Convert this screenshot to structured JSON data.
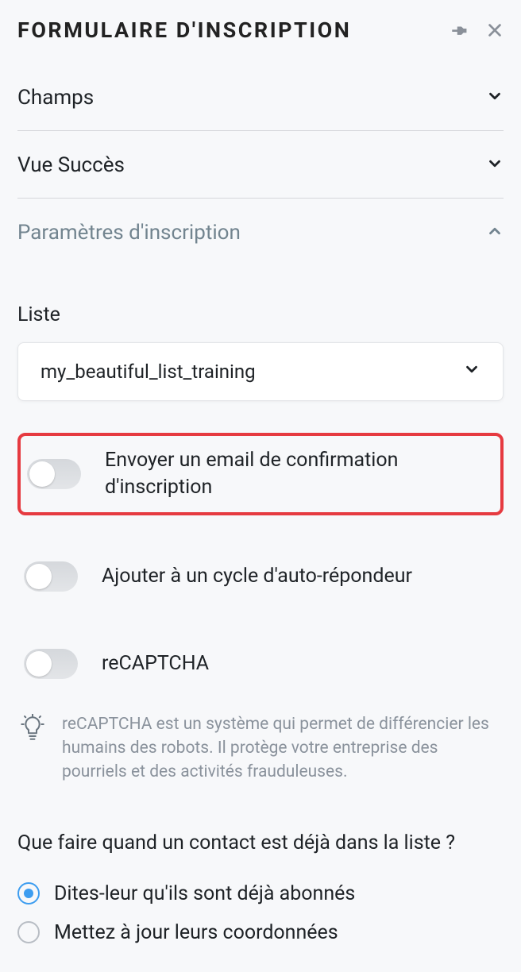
{
  "header": {
    "title": "FORMULAIRE D'INSCRIPTION"
  },
  "accordion": {
    "fields": "Champs",
    "success": "Vue Succès",
    "settings": "Paramètres d'inscription"
  },
  "list": {
    "label": "Liste",
    "selected": "my_beautiful_list_training"
  },
  "toggles": {
    "confirmation": "Envoyer un email de confirmation d'inscription",
    "autoresponder": "Ajouter à un cycle d'auto-répondeur",
    "recaptcha": "reCAPTCHA"
  },
  "info": {
    "recaptcha": "reCAPTCHA est un système qui permet de différencier les humains des robots. Il protège votre entreprise des pourriels et des activités frauduleuses."
  },
  "existing": {
    "question": "Que faire quand un contact est déjà dans la liste ?",
    "option1": "Dites-leur qu'ils sont déjà abonnés",
    "option2": "Mettez à jour leurs coordonnées"
  }
}
